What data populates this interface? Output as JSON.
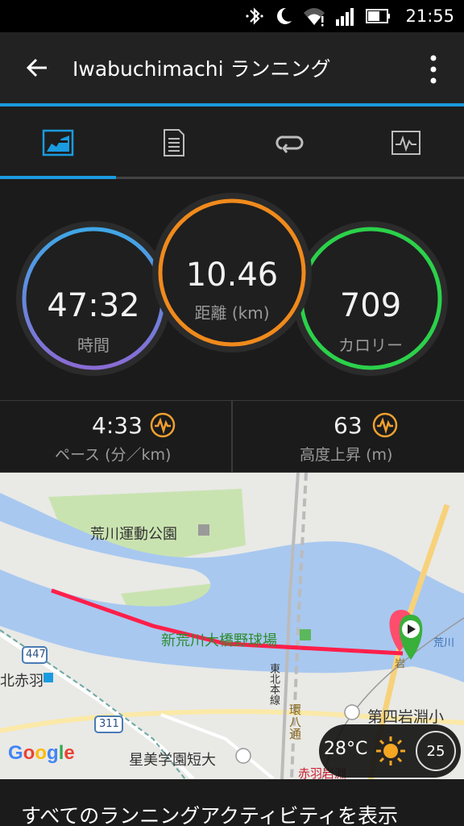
{
  "status_bar": {
    "time": "21:55"
  },
  "app_bar": {
    "title": "Iwabuchimachi ランニング"
  },
  "tabs": [
    {
      "name": "overview",
      "icon": "chart-overview-icon"
    },
    {
      "name": "details",
      "icon": "document-icon"
    },
    {
      "name": "laps",
      "icon": "loop-icon"
    },
    {
      "name": "graphs",
      "icon": "graph-icon"
    }
  ],
  "active_tab": 0,
  "rings": {
    "time": {
      "value": "47:32",
      "label": "時間",
      "color": "#8a6bd4"
    },
    "distance": {
      "value": "10.46",
      "label": "距離",
      "unit": "(km)",
      "color": "#f08a1c"
    },
    "calories": {
      "value": "709",
      "label": "カロリー",
      "color": "#2bd14a"
    }
  },
  "stats": {
    "pace": {
      "value": "4:33",
      "label": "ペース",
      "unit": "(分／km)"
    },
    "elevation": {
      "value": "63",
      "label": "高度上昇",
      "unit": "(m)"
    }
  },
  "map": {
    "labels": {
      "park": "荒川運動公園",
      "baseball": "新荒川大橋野球場",
      "kitaakabane": "北赤羽",
      "school": "第四岩淵小",
      "college": "星美学園短大",
      "rail": "東北本線",
      "road": "環八通",
      "akabane": "赤羽岩淵",
      "river": "荒川",
      "route447": "447",
      "route311": "311",
      "iwa": "岩"
    },
    "google": [
      "G",
      "o",
      "o",
      "g",
      "l",
      "e"
    ],
    "google_colors": [
      "#4285f4",
      "#ea4335",
      "#fbbc05",
      "#4285f4",
      "#34a853",
      "#ea4335"
    ]
  },
  "weather": {
    "temperature": "28°C",
    "rain_chance": "25"
  },
  "footer": {
    "link": "すべてのランニングアクティビティを表示"
  }
}
